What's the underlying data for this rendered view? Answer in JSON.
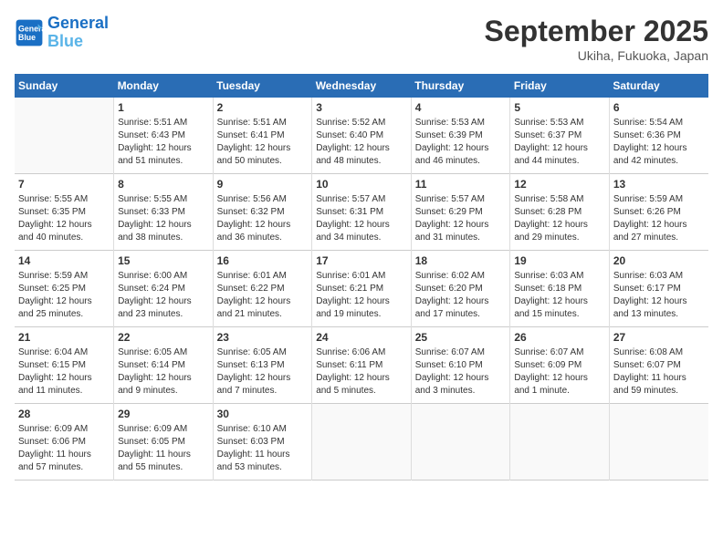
{
  "header": {
    "logo_line1": "General",
    "logo_line2": "Blue",
    "month": "September 2025",
    "location": "Ukiha, Fukuoka, Japan"
  },
  "weekdays": [
    "Sunday",
    "Monday",
    "Tuesday",
    "Wednesday",
    "Thursday",
    "Friday",
    "Saturday"
  ],
  "weeks": [
    [
      {
        "day": "",
        "info": ""
      },
      {
        "day": "1",
        "info": "Sunrise: 5:51 AM\nSunset: 6:43 PM\nDaylight: 12 hours\nand 51 minutes."
      },
      {
        "day": "2",
        "info": "Sunrise: 5:51 AM\nSunset: 6:41 PM\nDaylight: 12 hours\nand 50 minutes."
      },
      {
        "day": "3",
        "info": "Sunrise: 5:52 AM\nSunset: 6:40 PM\nDaylight: 12 hours\nand 48 minutes."
      },
      {
        "day": "4",
        "info": "Sunrise: 5:53 AM\nSunset: 6:39 PM\nDaylight: 12 hours\nand 46 minutes."
      },
      {
        "day": "5",
        "info": "Sunrise: 5:53 AM\nSunset: 6:37 PM\nDaylight: 12 hours\nand 44 minutes."
      },
      {
        "day": "6",
        "info": "Sunrise: 5:54 AM\nSunset: 6:36 PM\nDaylight: 12 hours\nand 42 minutes."
      }
    ],
    [
      {
        "day": "7",
        "info": "Sunrise: 5:55 AM\nSunset: 6:35 PM\nDaylight: 12 hours\nand 40 minutes."
      },
      {
        "day": "8",
        "info": "Sunrise: 5:55 AM\nSunset: 6:33 PM\nDaylight: 12 hours\nand 38 minutes."
      },
      {
        "day": "9",
        "info": "Sunrise: 5:56 AM\nSunset: 6:32 PM\nDaylight: 12 hours\nand 36 minutes."
      },
      {
        "day": "10",
        "info": "Sunrise: 5:57 AM\nSunset: 6:31 PM\nDaylight: 12 hours\nand 34 minutes."
      },
      {
        "day": "11",
        "info": "Sunrise: 5:57 AM\nSunset: 6:29 PM\nDaylight: 12 hours\nand 31 minutes."
      },
      {
        "day": "12",
        "info": "Sunrise: 5:58 AM\nSunset: 6:28 PM\nDaylight: 12 hours\nand 29 minutes."
      },
      {
        "day": "13",
        "info": "Sunrise: 5:59 AM\nSunset: 6:26 PM\nDaylight: 12 hours\nand 27 minutes."
      }
    ],
    [
      {
        "day": "14",
        "info": "Sunrise: 5:59 AM\nSunset: 6:25 PM\nDaylight: 12 hours\nand 25 minutes."
      },
      {
        "day": "15",
        "info": "Sunrise: 6:00 AM\nSunset: 6:24 PM\nDaylight: 12 hours\nand 23 minutes."
      },
      {
        "day": "16",
        "info": "Sunrise: 6:01 AM\nSunset: 6:22 PM\nDaylight: 12 hours\nand 21 minutes."
      },
      {
        "day": "17",
        "info": "Sunrise: 6:01 AM\nSunset: 6:21 PM\nDaylight: 12 hours\nand 19 minutes."
      },
      {
        "day": "18",
        "info": "Sunrise: 6:02 AM\nSunset: 6:20 PM\nDaylight: 12 hours\nand 17 minutes."
      },
      {
        "day": "19",
        "info": "Sunrise: 6:03 AM\nSunset: 6:18 PM\nDaylight: 12 hours\nand 15 minutes."
      },
      {
        "day": "20",
        "info": "Sunrise: 6:03 AM\nSunset: 6:17 PM\nDaylight: 12 hours\nand 13 minutes."
      }
    ],
    [
      {
        "day": "21",
        "info": "Sunrise: 6:04 AM\nSunset: 6:15 PM\nDaylight: 12 hours\nand 11 minutes."
      },
      {
        "day": "22",
        "info": "Sunrise: 6:05 AM\nSunset: 6:14 PM\nDaylight: 12 hours\nand 9 minutes."
      },
      {
        "day": "23",
        "info": "Sunrise: 6:05 AM\nSunset: 6:13 PM\nDaylight: 12 hours\nand 7 minutes."
      },
      {
        "day": "24",
        "info": "Sunrise: 6:06 AM\nSunset: 6:11 PM\nDaylight: 12 hours\nand 5 minutes."
      },
      {
        "day": "25",
        "info": "Sunrise: 6:07 AM\nSunset: 6:10 PM\nDaylight: 12 hours\nand 3 minutes."
      },
      {
        "day": "26",
        "info": "Sunrise: 6:07 AM\nSunset: 6:09 PM\nDaylight: 12 hours\nand 1 minute."
      },
      {
        "day": "27",
        "info": "Sunrise: 6:08 AM\nSunset: 6:07 PM\nDaylight: 11 hours\nand 59 minutes."
      }
    ],
    [
      {
        "day": "28",
        "info": "Sunrise: 6:09 AM\nSunset: 6:06 PM\nDaylight: 11 hours\nand 57 minutes."
      },
      {
        "day": "29",
        "info": "Sunrise: 6:09 AM\nSunset: 6:05 PM\nDaylight: 11 hours\nand 55 minutes."
      },
      {
        "day": "30",
        "info": "Sunrise: 6:10 AM\nSunset: 6:03 PM\nDaylight: 11 hours\nand 53 minutes."
      },
      {
        "day": "",
        "info": ""
      },
      {
        "day": "",
        "info": ""
      },
      {
        "day": "",
        "info": ""
      },
      {
        "day": "",
        "info": ""
      }
    ]
  ]
}
